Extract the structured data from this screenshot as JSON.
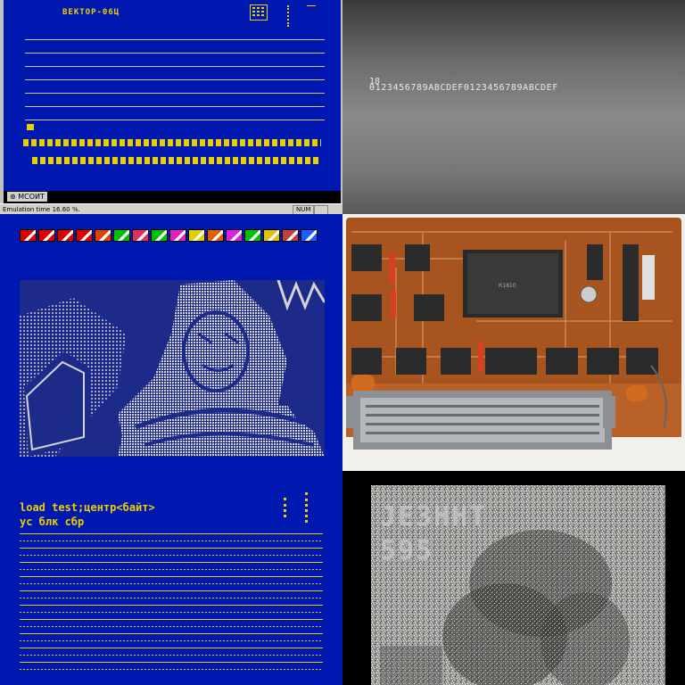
{
  "emulator": {
    "screen_title": "ВЕКТОР-06Ц",
    "taskbar_logo": "МСОИТ",
    "status_text": "Emulation time 16.60 %.",
    "status_num": "NUM"
  },
  "crt": {
    "line1": "18",
    "line2": "0123456789ABCDEF0123456789ABCDEF"
  },
  "editor": {
    "tools": [
      "screen-icon",
      "screen-icon",
      "screen-icon",
      "screen-icon",
      "paint-icon",
      "pencil-icon",
      "palette-icon",
      "window-icon",
      "ellipse-icon",
      "magnifier-icon",
      "fill-icon",
      "brush-icon",
      "xy-icon",
      "ab-icon",
      "disk-icon",
      "blank-icon"
    ],
    "tool_colors": [
      "#e00000",
      "#e00000",
      "#e00000",
      "#e00000",
      "#e04000",
      "#00c000",
      "#e03060",
      "#00c000",
      "#e020c0",
      "#e0d000",
      "#e06000",
      "#e020e0",
      "#00c000",
      "#e0c000",
      "#c04040",
      "#1a60ff"
    ]
  },
  "terminal": {
    "line1": "load test;центр<байт>",
    "line2": "ус блк сбр"
  },
  "noise_image": {
    "caption1": "JE3HHT",
    "caption2": "595"
  },
  "colors": {
    "screen_blue": "#0018b0",
    "text_yellow": "#e8d000",
    "pcb_brown": "#a8541e"
  }
}
